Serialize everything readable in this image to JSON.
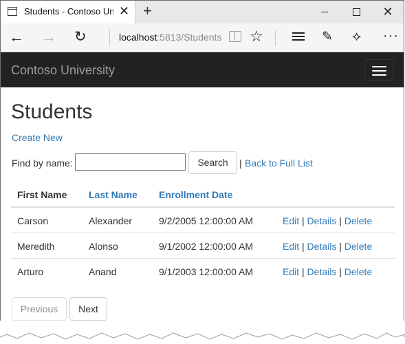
{
  "browser": {
    "tab_title": "Students - Contoso Univ",
    "url_host": "localhost",
    "url_rest": ":5813/Students"
  },
  "site": {
    "brand": "Contoso University"
  },
  "page": {
    "title": "Students",
    "create_new": "Create New",
    "find_label": "Find by name:",
    "search_value": "",
    "search_button": "Search",
    "separator": "|",
    "back_link": "Back to Full List"
  },
  "table": {
    "headers": [
      "First Name",
      "Last Name",
      "Enrollment Date"
    ],
    "rows": [
      {
        "first": "Carson",
        "last": "Alexander",
        "date": "9/2/2005 12:00:00 AM"
      },
      {
        "first": "Meredith",
        "last": "Alonso",
        "date": "9/1/2002 12:00:00 AM"
      },
      {
        "first": "Arturo",
        "last": "Anand",
        "date": "9/1/2003 12:00:00 AM"
      }
    ],
    "actions": {
      "edit": "Edit",
      "details": "Details",
      "delete": "Delete",
      "sep": "|"
    }
  },
  "pager": {
    "previous": "Previous",
    "next": "Next"
  },
  "colors": {
    "link": "#337ab7",
    "navbar": "#222222",
    "brand": "#9d9d9d"
  }
}
